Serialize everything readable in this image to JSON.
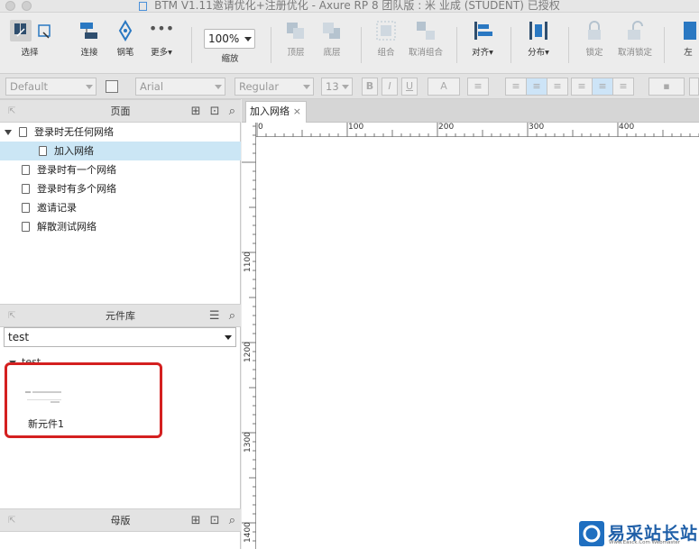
{
  "window": {
    "title": "BTM V1.11邀请优化+注册优化 - Axure RP 8 团队版 : 米 业成 (STUDENT) 已授权"
  },
  "toolbar": {
    "select_label": "选择",
    "connect_label": "连接",
    "pen_label": "钢笔",
    "more_label": "更多▾",
    "zoom_value": "100%",
    "zoom_label": "缩放",
    "top_label": "顶层",
    "bottom_label": "底层",
    "group_label": "组合",
    "ungroup_label": "取消组合",
    "align_label": "对齐▾",
    "distribute_label": "分布▾",
    "lock_label": "锁定",
    "unlock_label": "取消锁定",
    "left_label": "左"
  },
  "formatbar": {
    "style_value": "Default",
    "font_value": "Arial",
    "weight_value": "Regular",
    "size_value": "13",
    "bold": "B",
    "italic": "I",
    "underline": "U",
    "textcolor": "A"
  },
  "pages_panel": {
    "title": "页面",
    "items": [
      {
        "label": "登录时无任何网络"
      },
      {
        "label": "加入网络"
      },
      {
        "label": "登录时有一个网络"
      },
      {
        "label": "登录时有多个网络"
      },
      {
        "label": "邀请记录"
      },
      {
        "label": "解散测试网络"
      }
    ]
  },
  "library_panel": {
    "title": "元件库",
    "selected_library": "test",
    "group_label": "test",
    "widget_label": "新元件1"
  },
  "masters_panel": {
    "title": "母版"
  },
  "canvas": {
    "tab_label": "加入网络",
    "tab_close": "×",
    "h_ticks": [
      "0",
      "100",
      "200",
      "300",
      "400"
    ],
    "v_ticks": [
      "1100",
      "1200",
      "1300",
      "1400"
    ]
  },
  "watermark": {
    "text": "易采站长站",
    "sub": "Www.Easck.Com Webmaster"
  },
  "colors": {
    "highlight": "#d42020",
    "selected_row": "#cbe6f5",
    "accent": "#2a78c2"
  }
}
